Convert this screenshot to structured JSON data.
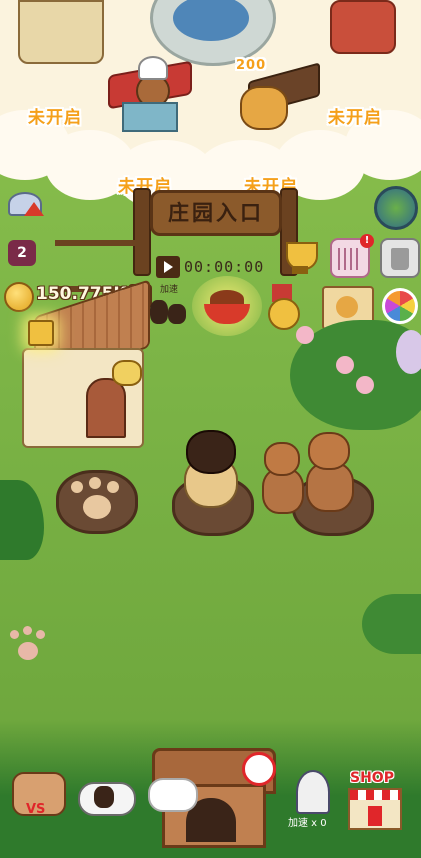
{
  "top_area": {
    "locked_left": "未开启",
    "locked_right": "未开启",
    "price_label": "200",
    "gate_locked_left": "未开启",
    "gate_locked_right": "未开启",
    "gate_sign": "庄园入口"
  },
  "hud": {
    "level": "2",
    "timer": "00:00:00",
    "coins": "150.775K",
    "speed_label": "加速",
    "plus_label": "+"
  },
  "bottom_bar": {
    "shop_label": "SHOP",
    "vs_label": "VS",
    "rocket_count_label": "加速 x 0"
  },
  "colors": {
    "grass": "#7db547",
    "accent_orange": "#f5a01a",
    "wood": "#8b5a2b",
    "bowl_red": "#d83a2a"
  }
}
